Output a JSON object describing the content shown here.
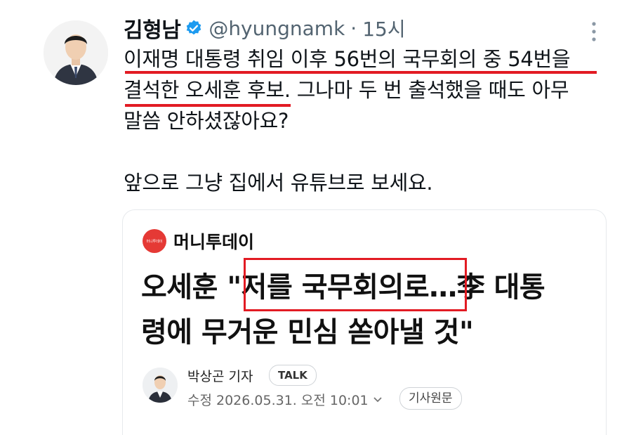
{
  "tweet": {
    "display_name": "김형남",
    "handle": "@hyungnamk",
    "separator": "·",
    "time": "15시",
    "lines": [
      "이재명 대통령 취임 이후 56번의 국무회의 중 54번을",
      "결석한 오세훈 후보. 그나마 두 번 출석했을 때도 아무",
      "말씀 안하셨잖아요?"
    ],
    "line_after_gap": "앞으로 그냥 집에서 유튜브로 보세요."
  },
  "card": {
    "source_logo_text": "머니투데이",
    "source_name": "머니투데이",
    "headline_line1": "오세훈 \"저를 국무회의로…李 대통",
    "headline_line2": "령에 무거운 민심 쏟아낼 것\"",
    "reporter": "박상곤 기자",
    "talk_label": "TALK",
    "modified": "수정 2026.05.31. 오전 10:01",
    "original_button": "기사원문"
  },
  "colors": {
    "verified": "#1d9bf0",
    "highlight_red": "#e21b23",
    "source_red": "#e53935"
  }
}
